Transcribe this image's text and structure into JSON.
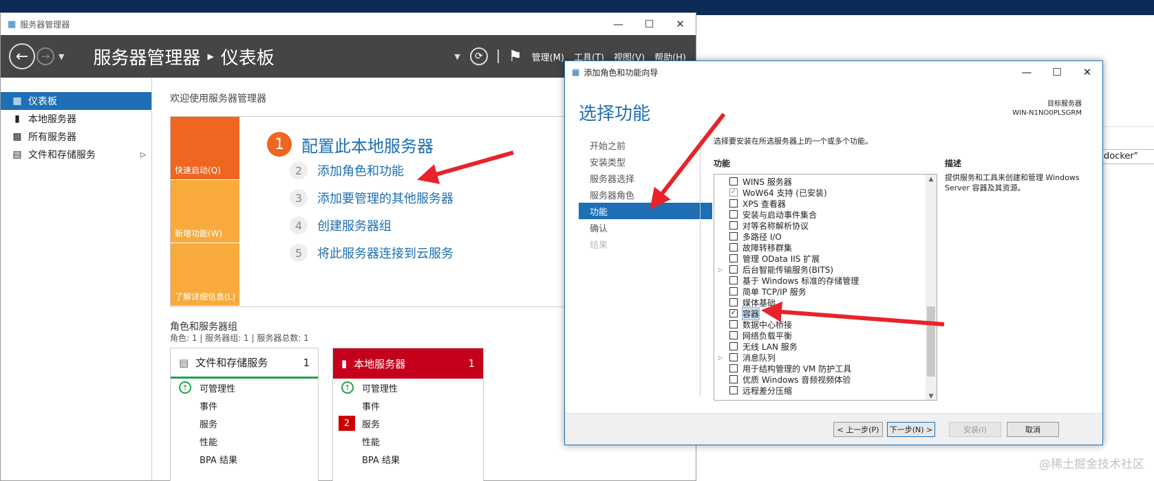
{
  "server_manager": {
    "title": "服务器管理器",
    "breadcrumb_app": "服务器管理器",
    "breadcrumb_page": "仪表板",
    "menus": [
      "管理(M)",
      "工具(T)",
      "视图(V)",
      "帮助(H)"
    ],
    "nav": [
      {
        "label": "仪表板",
        "icon": "dashboard-icon",
        "active": true
      },
      {
        "label": "本地服务器",
        "icon": "server-icon"
      },
      {
        "label": "所有服务器",
        "icon": "servers-icon"
      },
      {
        "label": "文件和存储服务",
        "icon": "storage-icon",
        "expandable": true
      }
    ],
    "welcome": "欢迎使用服务器管理器",
    "quick_tabs": [
      "快速启动(Q)",
      "新增功能(W)",
      "了解详细信息(L)"
    ],
    "step1": {
      "num": "1",
      "label": "配置此本地服务器"
    },
    "steps": [
      {
        "num": "2",
        "label": "添加角色和功能"
      },
      {
        "num": "3",
        "label": "添加要管理的其他服务器"
      },
      {
        "num": "4",
        "label": "创建服务器组"
      },
      {
        "num": "5",
        "label": "将此服务器连接到云服务"
      }
    ],
    "roles_title": "角色和服务器组",
    "roles_sub": "角色: 1 | 服务器组: 1 | 服务器总数: 1",
    "tiles": [
      {
        "title": "文件和存储服务",
        "count": "1",
        "rows": [
          "可管理性",
          "事件",
          "服务",
          "性能",
          "BPA 结果"
        ]
      },
      {
        "title": "本地服务器",
        "count": "1",
        "rows": [
          "可管理性",
          "事件",
          "服务",
          "性能",
          "BPA 结果"
        ],
        "service_badge": "2"
      }
    ]
  },
  "wizard": {
    "title": "添加角色和功能向导",
    "heading": "选择功能",
    "target_label": "目标服务器",
    "target_name": "WIN-N1NO0PLSGRM",
    "nav": [
      "开始之前",
      "安装类型",
      "服务器选择",
      "服务器角色",
      "功能",
      "确认",
      "结果"
    ],
    "instruction": "选择要安装在所选服务器上的一个或多个功能。",
    "features_label": "功能",
    "description_label": "描述",
    "description": "提供服务和工具来创建和管理 Windows Server 容器及其资源。",
    "features": [
      {
        "label": "WINS 服务器",
        "state": "unchecked"
      },
      {
        "label": "WoW64 支持 (已安装)",
        "state": "installed"
      },
      {
        "label": "XPS 查看器",
        "state": "unchecked"
      },
      {
        "label": "安装与启动事件集合",
        "state": "unchecked"
      },
      {
        "label": "对等名称解析协议",
        "state": "unchecked"
      },
      {
        "label": "多路径 I/O",
        "state": "unchecked"
      },
      {
        "label": "故障转移群集",
        "state": "unchecked"
      },
      {
        "label": "管理 OData IIS 扩展",
        "state": "unchecked"
      },
      {
        "label": "后台智能传输服务(BITS)",
        "state": "unchecked",
        "expandable": true
      },
      {
        "label": "基于 Windows 标准的存储管理",
        "state": "unchecked"
      },
      {
        "label": "简单 TCP/IP 服务",
        "state": "unchecked"
      },
      {
        "label": "媒体基础",
        "state": "unchecked"
      },
      {
        "label": "容器",
        "state": "checked",
        "selected": true
      },
      {
        "label": "数据中心桥接",
        "state": "unchecked"
      },
      {
        "label": "网络负载平衡",
        "state": "unchecked"
      },
      {
        "label": "无线 LAN 服务",
        "state": "unchecked"
      },
      {
        "label": "消息队列",
        "state": "unchecked",
        "expandable": true
      },
      {
        "label": "用于结构管理的 VM 防护工具",
        "state": "unchecked"
      },
      {
        "label": "优质 Windows 音频视频体验",
        "state": "unchecked"
      },
      {
        "label": "远程差分压缩",
        "state": "unchecked"
      }
    ],
    "buttons": {
      "prev": "< 上一步(P)",
      "next": "下一步(N) >",
      "install": "安装(I)",
      "cancel": "取消"
    }
  },
  "background": {
    "search_text": "\"docker\""
  },
  "watermark": "@稀土掘金技术社区",
  "colors": {
    "accent": "#1e6fb5",
    "annotation_arrow": "#e8232a"
  }
}
